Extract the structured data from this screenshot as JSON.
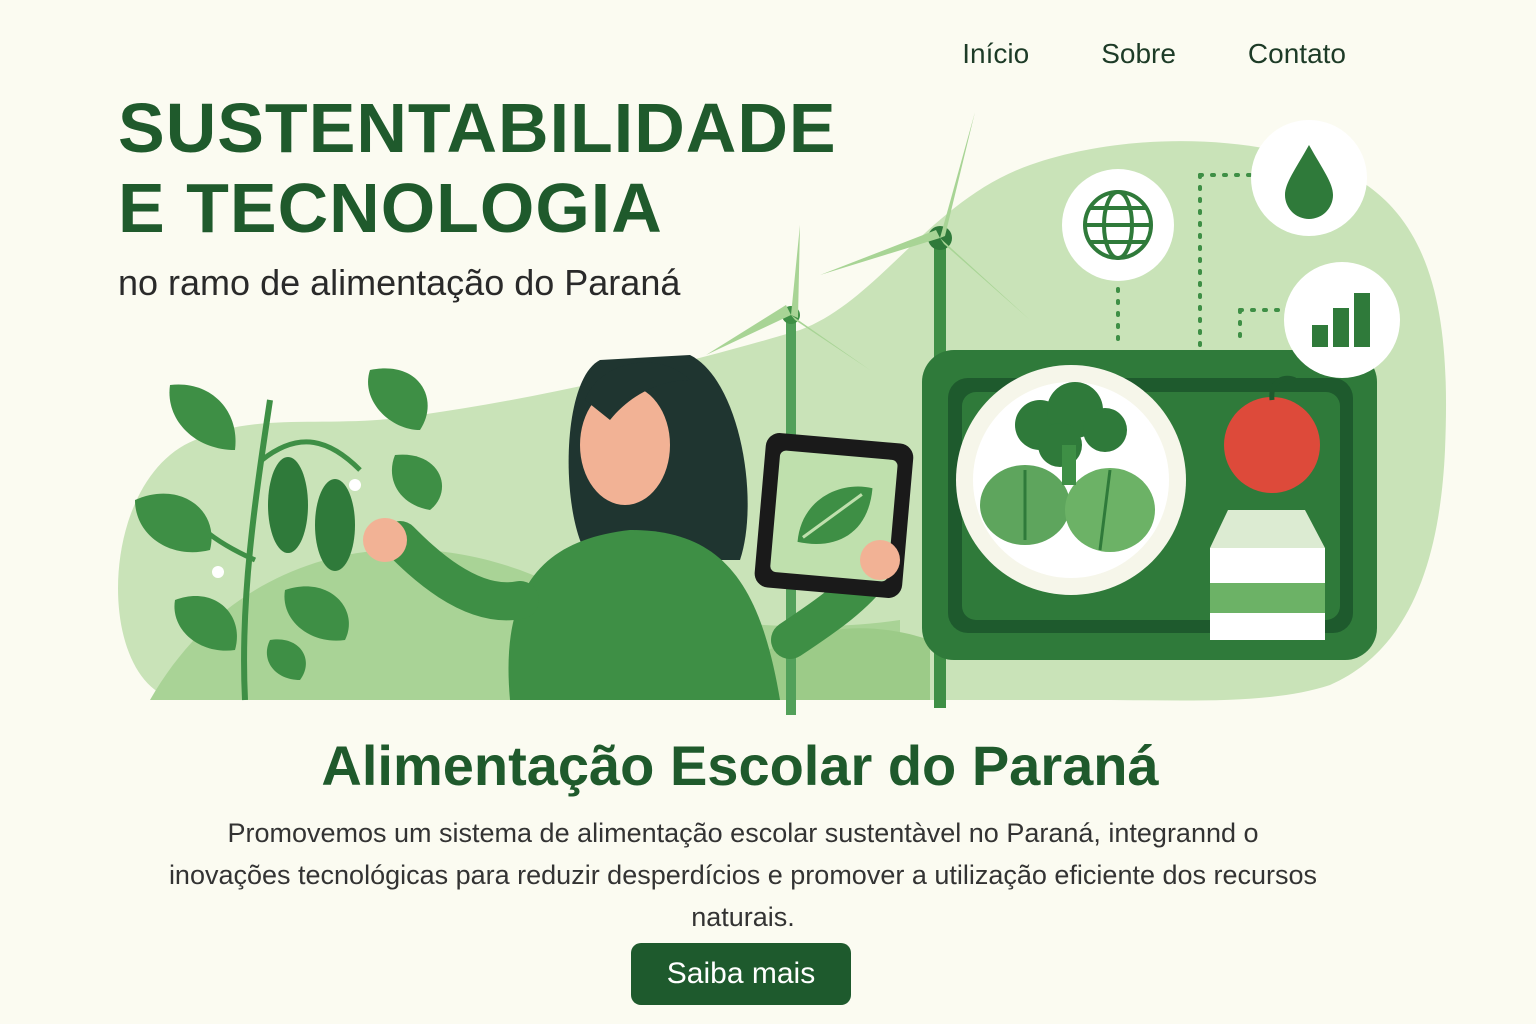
{
  "nav": {
    "items": [
      "Início",
      "Sobre",
      "Contato"
    ]
  },
  "hero": {
    "title": "SUSTENTABILIDADE\nE TECNOLOGIA",
    "subtitle": "no ramo de alimentação do Paraná"
  },
  "section": {
    "title": "Alimentação Escolar do Paraná",
    "description": "Promovemos um sistema de alimentação escolar sustentàvel no Paraná, integrannd o inovações tecnológicas para reduzir desperdícios e promover a utilização eficiente dos recursos naturais."
  },
  "cta": {
    "label": "Saiba mais"
  },
  "icons": [
    "globe-icon",
    "water-drop-icon",
    "bar-chart-icon",
    "leaf-icon"
  ],
  "colors": {
    "background": "#fbfbf1",
    "primary_green": "#1e5a2d",
    "light_green": "#c7e2b4",
    "mid_green": "#3e8f45",
    "apple_red": "#dd4a3a"
  }
}
